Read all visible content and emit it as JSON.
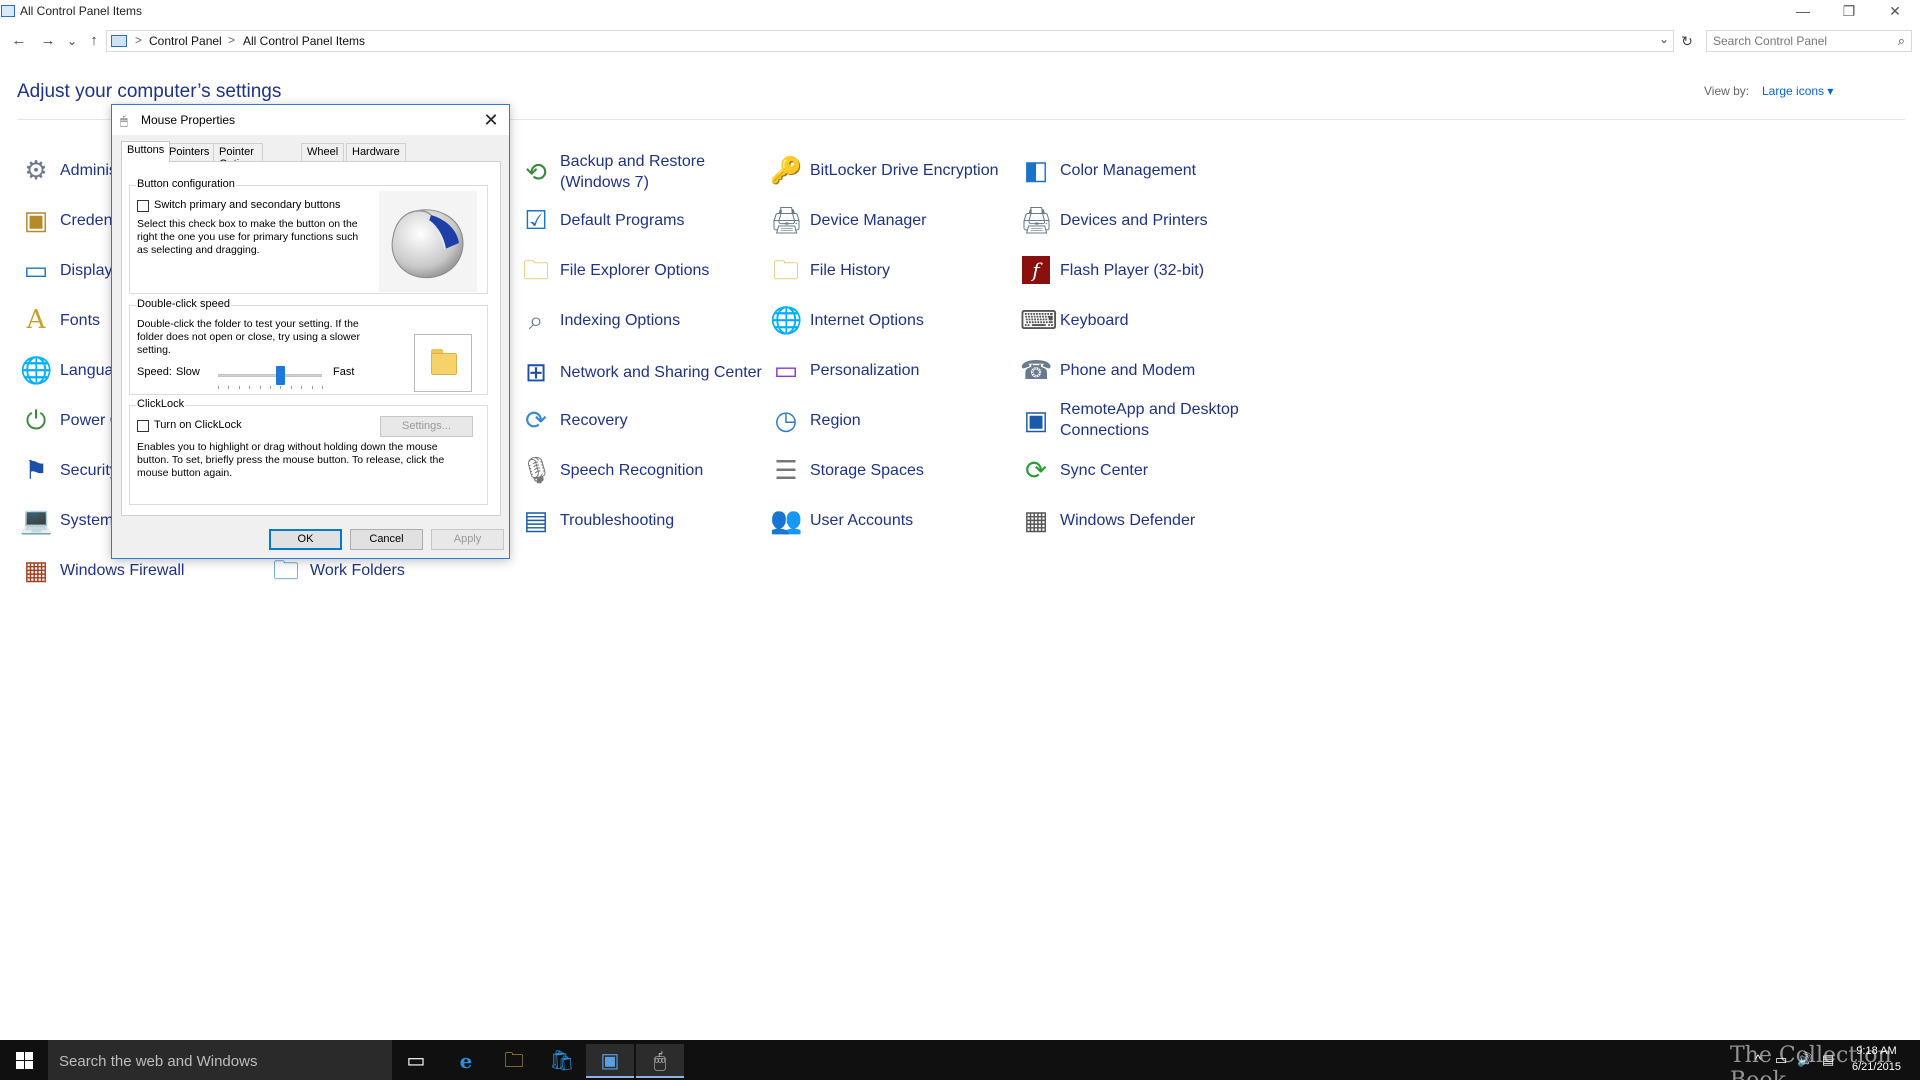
{
  "window": {
    "title": "All Control Panel Items",
    "minimize": "—",
    "restore": "❐",
    "close": "✕"
  },
  "address": {
    "back": "←",
    "forward": "→",
    "recent": "⌄",
    "up": "↑",
    "crumbs": [
      "Control Panel",
      "All Control Panel Items"
    ],
    "separator": ">",
    "refresh": "↻",
    "search_placeholder": "Search Control Panel"
  },
  "header": {
    "title": "Adjust your computer’s settings",
    "view_by_label": "View by:",
    "view_by_value": "Large icons ▾"
  },
  "items": [
    {
      "label": "Administrative Tools",
      "icon": "admin-tools-icon"
    },
    {
      "label": "Credential Manager",
      "icon": "credential-manager-icon"
    },
    {
      "label": "Display",
      "icon": "display-icon"
    },
    {
      "label": "Fonts",
      "icon": "fonts-icon"
    },
    {
      "label": "Language",
      "icon": "language-icon"
    },
    {
      "label": "Power Options",
      "icon": "power-options-icon"
    },
    {
      "label": "Security and Maintenance",
      "icon": "security-flag-icon"
    },
    {
      "label": "System",
      "icon": "system-icon"
    },
    {
      "label": "Windows Firewall",
      "icon": "firewall-icon"
    },
    {
      "label": "Work Folders",
      "icon": "work-folders-icon"
    },
    {
      "label": "Backup and Restore (Windows 7)",
      "icon": "backup-icon"
    },
    {
      "label": "Default Programs",
      "icon": "default-programs-icon"
    },
    {
      "label": "File Explorer Options",
      "icon": "folder-options-icon"
    },
    {
      "label": "Indexing Options",
      "icon": "indexing-icon"
    },
    {
      "label": "Network and Sharing Center",
      "icon": "network-icon"
    },
    {
      "label": "Recovery",
      "icon": "recovery-icon"
    },
    {
      "label": "Speech Recognition",
      "icon": "microphone-icon"
    },
    {
      "label": "Troubleshooting",
      "icon": "troubleshooting-icon"
    },
    {
      "label": "BitLocker Drive Encryption",
      "icon": "bitlocker-icon"
    },
    {
      "label": "Device Manager",
      "icon": "device-manager-icon"
    },
    {
      "label": "File History",
      "icon": "file-history-icon"
    },
    {
      "label": "Internet Options",
      "icon": "globe-icon"
    },
    {
      "label": "Personalization",
      "icon": "personalization-icon"
    },
    {
      "label": "Region",
      "icon": "region-icon"
    },
    {
      "label": "Storage Spaces",
      "icon": "storage-spaces-icon"
    },
    {
      "label": "User Accounts",
      "icon": "user-accounts-icon"
    },
    {
      "label": "Color Management",
      "icon": "color-management-icon"
    },
    {
      "label": "Devices and Printers",
      "icon": "printer-icon"
    },
    {
      "label": "Flash Player (32-bit)",
      "icon": "flash-player-icon"
    },
    {
      "label": "Keyboard",
      "icon": "keyboard-icon"
    },
    {
      "label": "Phone and Modem",
      "icon": "phone-modem-icon"
    },
    {
      "label": "RemoteApp and Desktop Connections",
      "icon": "remoteapp-icon"
    },
    {
      "label": "Sync Center",
      "icon": "sync-icon"
    },
    {
      "label": "Windows Defender",
      "icon": "defender-icon"
    }
  ],
  "dialog": {
    "title": "Mouse Properties",
    "close": "✕",
    "tabs": [
      "Buttons",
      "Pointers",
      "Pointer Options",
      "Wheel",
      "Hardware"
    ],
    "active_tab": "Buttons",
    "button_config": {
      "title": "Button configuration",
      "checkbox_label": "Switch primary and secondary buttons",
      "checked": false,
      "description_lines": [
        "Select this check box to make the button on the",
        "right the one you use for primary functions such",
        "as selecting and dragging."
      ]
    },
    "double_click": {
      "title": "Double-click speed",
      "description_lines": [
        "Double-click the folder to test your setting. If the",
        "folder does not open or close, try using a slower",
        "setting."
      ],
      "speed_label": "Speed:",
      "slow_label": "Slow",
      "fast_label": "Fast",
      "speed_value": 0.6
    },
    "clicklock": {
      "title": "ClickLock",
      "checkbox_label": "Turn on ClickLock",
      "checked": false,
      "settings_button": "Settings...",
      "description_lines": [
        "Enables you to highlight or drag without holding down the mouse",
        "button. To set, briefly press the mouse button. To release, click the",
        "mouse button again."
      ]
    },
    "ok": "OK",
    "cancel": "Cancel",
    "apply": "Apply"
  },
  "taskbar": {
    "search_text": "Search the web and Windows",
    "watermark": "The Collection Book",
    "time": "9:18 AM",
    "date": "6/21/2015",
    "icons": [
      "task-view-icon",
      "edge-icon",
      "file-explorer-icon",
      "store-icon",
      "control-panel-icon",
      "mouse-properties-icon"
    ]
  },
  "colors": {
    "link_blue": "#1e3287",
    "accent": "#0078d7",
    "taskbar": "#101010"
  }
}
